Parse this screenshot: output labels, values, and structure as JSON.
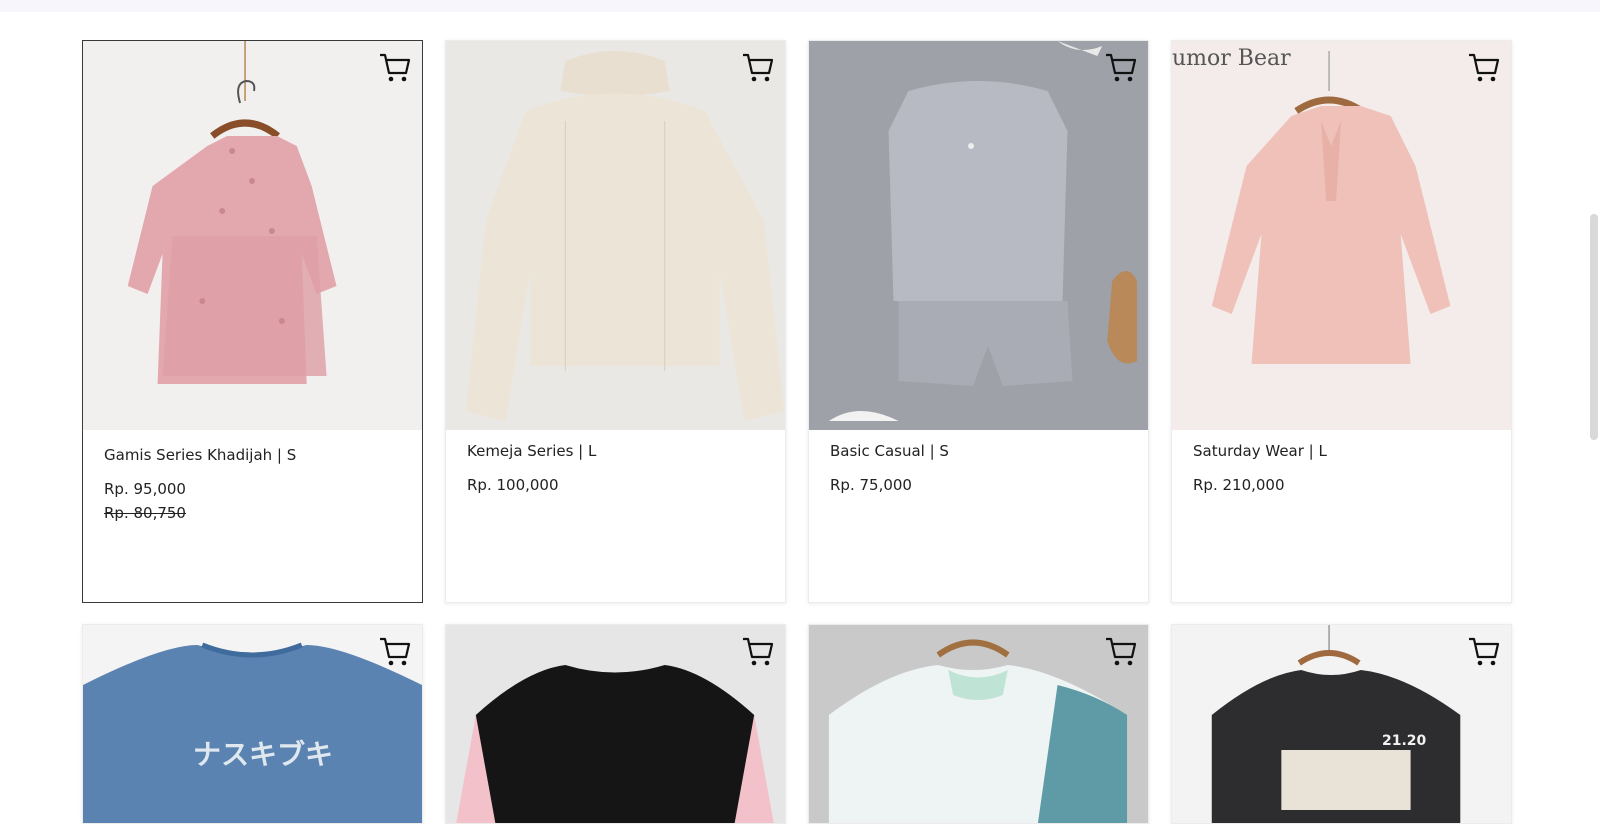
{
  "products": [
    {
      "name": "Gamis Series Khadijah | S",
      "price": "Rp. 95,000",
      "original_price": "Rp. 80,750",
      "icon": "cart-icon"
    },
    {
      "name": "Kemeja Series | L",
      "price": "Rp. 100,000",
      "icon": "cart-icon"
    },
    {
      "name": "Basic Casual | S",
      "price": "Rp. 75,000",
      "icon": "cart-icon"
    },
    {
      "name": "Saturday Wear | L",
      "price": "Rp. 210,000",
      "icon": "cart-icon",
      "brand_watermark": "umor Bear"
    }
  ],
  "second_row": [
    {
      "icon": "cart-icon",
      "tshirt_text": "ナスキブキ"
    },
    {
      "icon": "cart-icon"
    },
    {
      "icon": "cart-icon"
    },
    {
      "icon": "cart-icon",
      "tshirt_text": "21.20"
    }
  ]
}
